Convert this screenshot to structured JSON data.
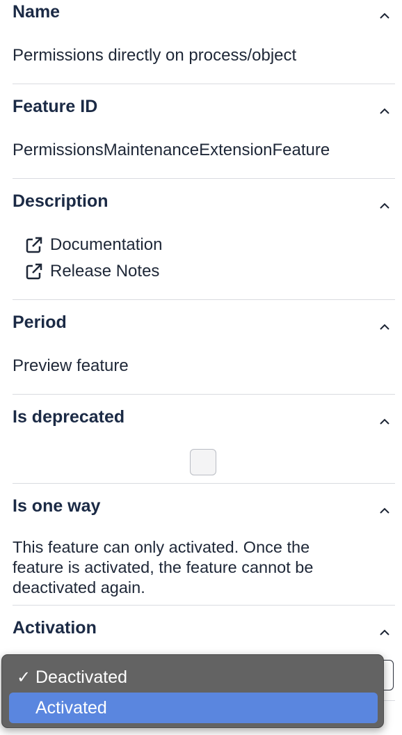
{
  "sections": {
    "name": {
      "title": "Name",
      "value": "Permissions directly on process/object"
    },
    "feature_id": {
      "title": "Feature ID",
      "value": "PermissionsMaintenanceExtensionFeature"
    },
    "description": {
      "title": "Description",
      "links": [
        {
          "label": "Documentation",
          "icon": "external-link-icon"
        },
        {
          "label": "Release Notes",
          "icon": "external-link-icon"
        }
      ]
    },
    "period": {
      "title": "Period",
      "value": "Preview feature"
    },
    "is_deprecated": {
      "title": "Is deprecated",
      "checked": false
    },
    "is_one_way": {
      "title": "Is one way",
      "lines": [
        "This feature can only activated. Once the",
        "feature is activated, the feature cannot be",
        "deactivated again."
      ]
    },
    "activation": {
      "title": "Activation",
      "options": [
        {
          "label": "Deactivated",
          "check": "✓"
        },
        {
          "label": "Activated",
          "check": ""
        }
      ]
    }
  },
  "colors": {
    "title": "#1b2a45",
    "divider": "#d9dbe0",
    "dropdown_bg": "#636363",
    "highlight": "#5a86df"
  }
}
